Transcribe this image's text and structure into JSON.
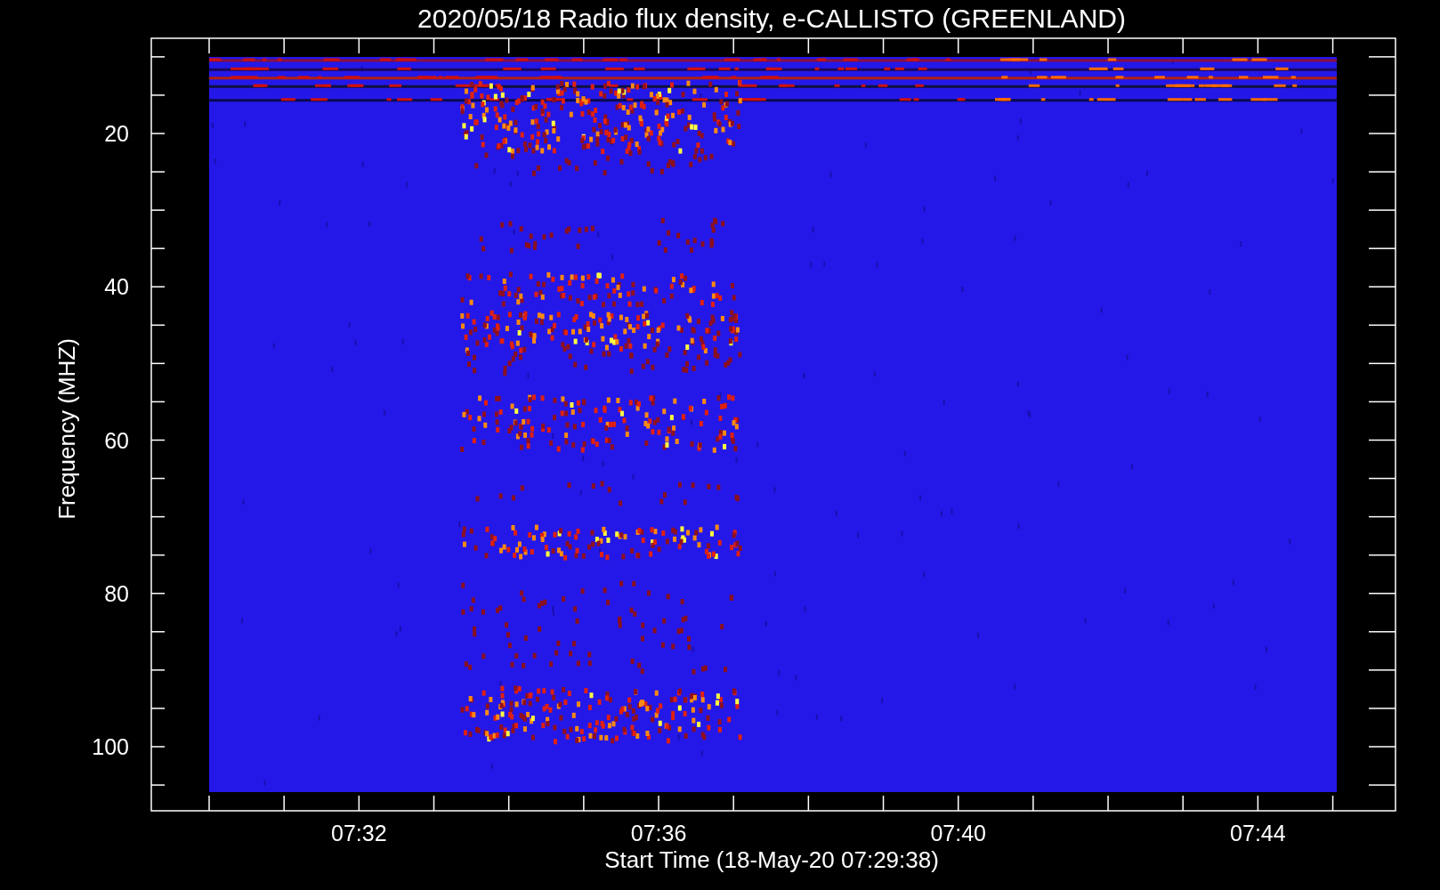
{
  "title": "2020/05/18  Radio flux density, e-CALLISTO (GREENLAND)",
  "y_axis": {
    "title": "Frequency (MHZ)",
    "tick_labels": [
      "20",
      "40",
      "60",
      "80",
      "100"
    ]
  },
  "x_axis": {
    "title": "Start Time (18-May-20 07:29:38)",
    "tick_labels": [
      "07:32",
      "07:36",
      "07:40",
      "07:44"
    ]
  }
}
